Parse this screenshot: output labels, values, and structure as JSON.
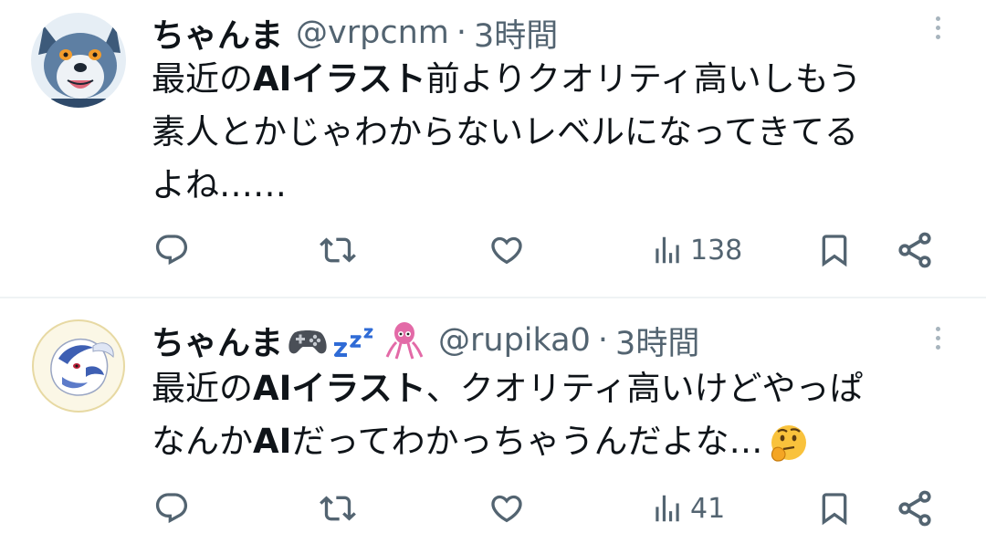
{
  "tweets": [
    {
      "display_name": "ちゃんま",
      "name_emojis": [],
      "handle": "@vrpcnm",
      "separator": "·",
      "time": "3時間",
      "avatar_icon": "wolf-avatar",
      "text_lines": [
        [
          {
            "text": "最近の",
            "bold": false
          },
          {
            "text": "AIイラスト",
            "bold": true
          },
          {
            "text": "前よりクオリティ高いしもう",
            "bold": false
          }
        ],
        [
          {
            "text": "素人とかじゃわからないレベルになってきてる",
            "bold": false
          }
        ],
        [
          {
            "text": "よね……",
            "bold": false
          }
        ]
      ],
      "views": "138"
    },
    {
      "display_name": "ちゃんま",
      "name_emojis": [
        "game-controller-icon",
        "zzz-icon",
        "squid-icon"
      ],
      "handle": "@rupika0",
      "separator": "·",
      "time": "3時間",
      "avatar_icon": "pokemon-avatar",
      "text_lines": [
        [
          {
            "text": "最近の",
            "bold": false
          },
          {
            "text": "AIイラスト",
            "bold": true
          },
          {
            "text": "、クオリティ高いけどやっぱ",
            "bold": false
          }
        ],
        [
          {
            "text": "なんか",
            "bold": false
          },
          {
            "text": "AI",
            "bold": true
          },
          {
            "text": "だってわかっちゃうんだよな…",
            "bold": false
          },
          {
            "emoji": "thinking-face-icon"
          }
        ]
      ],
      "views": "41"
    }
  ],
  "colors": {
    "text": "#0f1419",
    "muted": "#536471",
    "divider": "#eff3f4"
  }
}
